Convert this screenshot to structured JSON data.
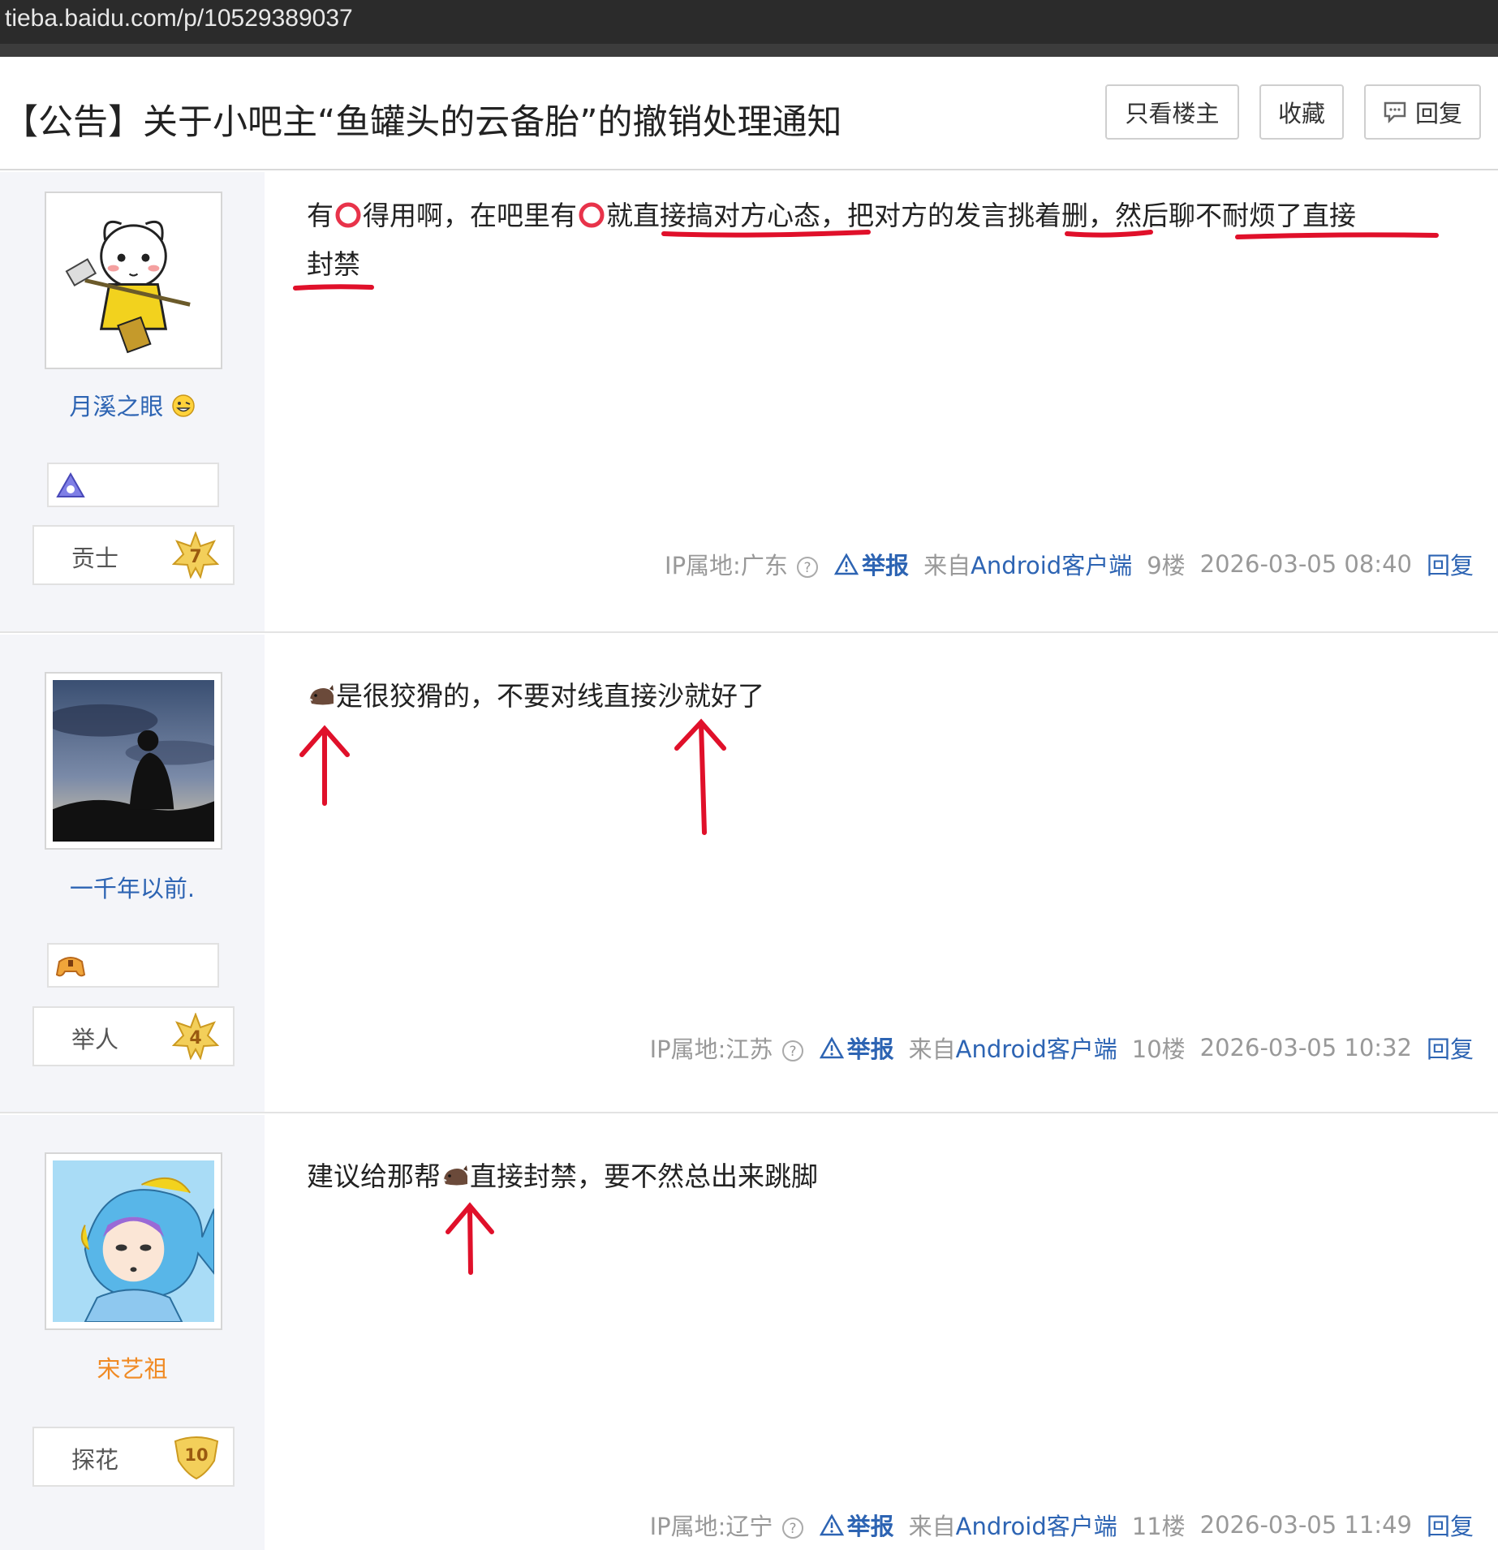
{
  "browser": {
    "url": "tieba.baidu.com/p/10529389037"
  },
  "thread": {
    "title": "【公告】关于小吧主“鱼罐头的云备胎”的撤销处理通知",
    "buttons": {
      "only_op": "只看楼主",
      "favorite": "收藏",
      "reply": "回复"
    }
  },
  "posts": [
    {
      "username": "月溪之眼",
      "level_name": "贡士",
      "level": "7",
      "content_line1_a": "有",
      "content_line1_b": "得用啊，在吧里有",
      "content_line1_c": "就直接搞对方心态，把对方的发言挑着删，然后聊不耐烦了直接",
      "content_line2": "封禁",
      "ip": "IP属地:广东",
      "report": "举报",
      "client": "来自Android客户端",
      "floor": "9楼",
      "time": "2026-03-05 08:40",
      "reply": "回复"
    },
    {
      "username": "一千年以前.",
      "level_name": "举人",
      "level": "4",
      "content": "是很狡猾的，不要对线直接沙就好了",
      "ip": "IP属地:江苏",
      "report": "举报",
      "client": "来自Android客户端",
      "floor": "10楼",
      "time": "2026-03-05 10:32",
      "reply": "回复"
    },
    {
      "username": "宋艺祖",
      "level_name": "探花",
      "level": "10",
      "content_a": "建议给那帮",
      "content_b": "直接封禁，要不然总出来跳脚",
      "ip": "IP属地:辽宁",
      "report": "举报",
      "client": "来自Android客户端",
      "floor": "11楼",
      "time": "2026-03-05 11:49",
      "reply": "回复"
    }
  ],
  "colors": {
    "accent_link": "#2d64b3",
    "annotation_red": "#e0102a",
    "vip_name": "#f08a24",
    "badge_gold": "#e9b935"
  },
  "icons": [
    "ring-emoji-icon",
    "boar-emoji-icon",
    "grin-emoji-icon",
    "question-icon",
    "warning-icon",
    "comment-icon",
    "level-star-icon"
  ]
}
